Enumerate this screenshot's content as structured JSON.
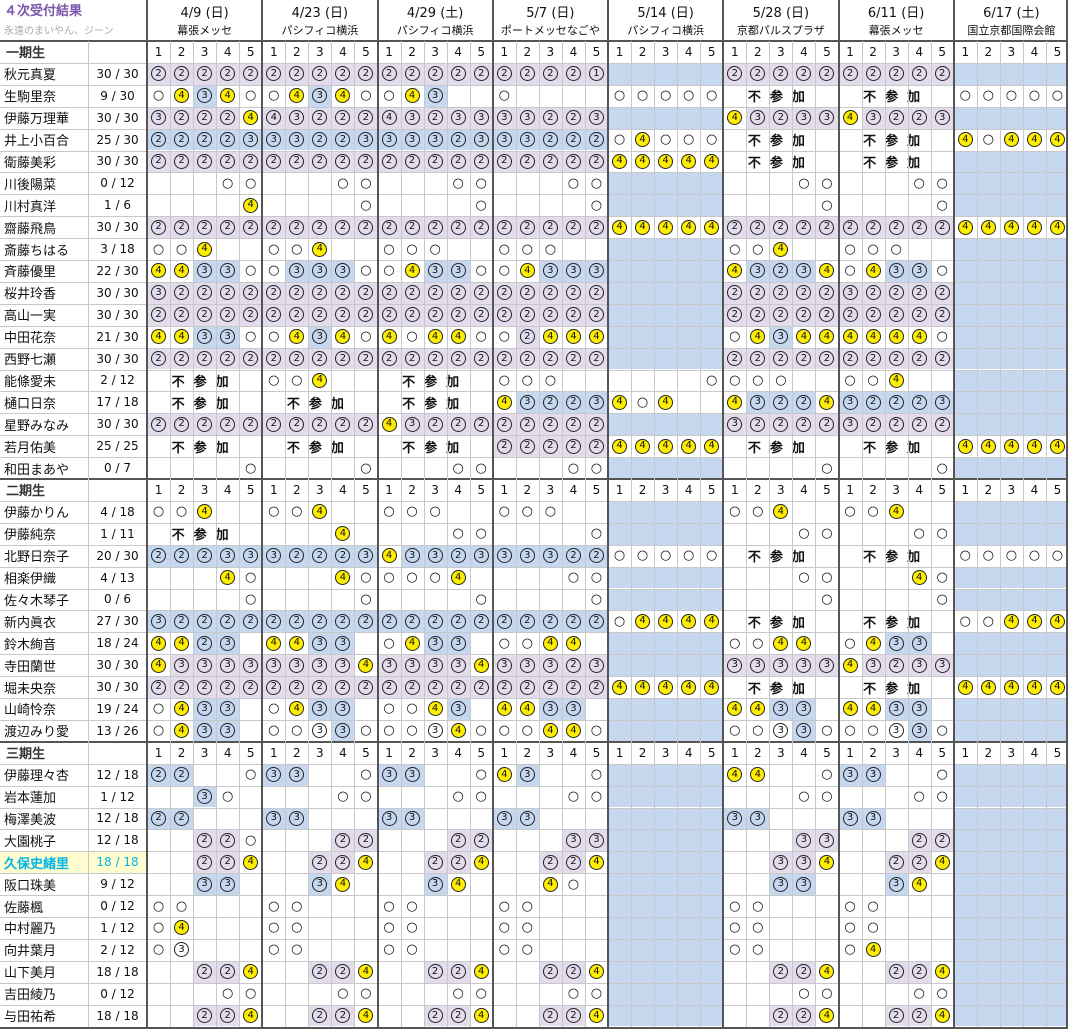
{
  "title": "４次受付結果",
  "subtitle": "永遠のまいやん、ジーン",
  "events": [
    {
      "date": "4/9 (日)",
      "venue": "幕張メッセ"
    },
    {
      "date": "4/23 (日)",
      "venue": "パシフィコ横浜"
    },
    {
      "date": "4/29 (土)",
      "venue": "パシフィコ横浜"
    },
    {
      "date": "5/7 (日)",
      "venue": "ポートメッセなごや"
    },
    {
      "date": "5/14 (日)",
      "venue": "パシフィコ横浜"
    },
    {
      "date": "5/28 (日)",
      "venue": "京都パルスプラザ"
    },
    {
      "date": "6/11 (日)",
      "venue": "幕張メッセ"
    },
    {
      "date": "6/17 (土)",
      "venue": "国立京都国際会館"
    }
  ],
  "slots": [
    "1",
    "2",
    "3",
    "4",
    "5"
  ],
  "fushanka": "不参加",
  "legend": {
    "B": "#c5d8f0",
    "L": "#e2dcec",
    "Y": "#ffee00",
    "o": "○",
    "r2": "②",
    "r3": "③",
    "r4": "④",
    "r1": "①"
  },
  "colors": {
    "title": "#7a55a8",
    "highlight_name": "#00b7e6",
    "highlight_bg": "#fffccf"
  },
  "sections": [
    {
      "label": "一期生",
      "members": [
        {
          "name": "秋元真夏",
          "count": "30 / 30",
          "rows": [
            "L2L2L2L2L2",
            "L2L2L2L2L2",
            "L2L2L2L2L2",
            "L2L2L2L2L1",
            "BBBBB",
            "L2L2L2L2L2",
            "L2L2L2L2L2",
            "BBBBB"
          ]
        },
        {
          "name": "生駒里奈",
          "count": "9 / 30",
          "rows": [
            " o Y4 B3 Y4 o",
            " o Y4 B3 Y4 o",
            " o Y4 B3 .. ..",
            " o .. .. Y4 o",
            "ooooo",
            "F",
            "F",
            "ooooo"
          ]
        },
        {
          "name": "伊藤万理華",
          "count": "30 / 30",
          "rows": [
            "L3L2L2L2Y4",
            "L4L3L2L2L2",
            "L4L3L2L3L3",
            "L3L3L2L2L3",
            "BBBBB",
            "Y4L3L2L3L3",
            "Y4L3L2L2L3",
            "BBBBB"
          ]
        },
        {
          "name": "井上小百合",
          "count": "25 / 30",
          "rows": [
            "B2B2B2B2B3",
            "B3B3B2B2B3",
            "B3B3B3B2B3",
            "B3B3B2B2B2",
            "oY4ooo",
            "F",
            "F",
            "Y4oY4Y4Y4"
          ]
        },
        {
          "name": "衛藤美彩",
          "count": "30 / 30",
          "rows": [
            "L2L2L2L2L2",
            "L2L2L2L2L2",
            "L2L2L2L2L2",
            "L2L2L2L2L2",
            "Y4Y4Y4Y4Y4",
            "F",
            "F",
            "BBBBB"
          ]
        },
        {
          "name": "川後陽菜",
          "count": "0 / 12",
          "rows": [
            "...oo",
            "...oo",
            "...oo",
            "...oo",
            "BBBBB",
            "...oo",
            "...oo",
            "BBBBB"
          ]
        },
        {
          "name": "川村真洋",
          "count": "1 / 6",
          "rows": [
            "....Y4",
            "....o",
            "....o",
            "....o",
            "BBBBB",
            "....o",
            "....o",
            "BBBBB"
          ]
        },
        {
          "name": "齋藤飛鳥",
          "count": "30 / 30",
          "rows": [
            "L2L2L2L2L2",
            "L2L2L2L2L2",
            "L2L2L2L2L2",
            "L2L2L2L2L2",
            "Y4Y4Y4Y4Y4",
            "L2L2L2L2L2",
            "L2L2L2L2L2",
            "Y4Y4Y4Y4Y4"
          ]
        },
        {
          "name": "斎藤ちはる",
          "count": "3 / 18",
          "rows": [
            "ooY4..",
            "ooY4..",
            "ooo..",
            "ooo..",
            "BBBBB",
            "ooY4..",
            "ooo..",
            "BBBBB"
          ]
        },
        {
          "name": "斉藤優里",
          "count": "22 / 30",
          "rows": [
            "Y4Y4B3B3o",
            "oB3B3B3o",
            "oY4B3B3o",
            "oY4B3B3B3",
            "BBBBB",
            "Y4B3B2B3Y4",
            "oY4B3B3o",
            "BBBBB"
          ]
        },
        {
          "name": "桜井玲香",
          "count": "30 / 30",
          "rows": [
            "L3L2L2L2L2",
            "L2L2L2L2L2",
            "L2L2L2L2L2",
            "L2L2L2L2L2",
            "BBBBB",
            "L2L2L2L2L2",
            "L3L2L2L2L2",
            "BBBBB"
          ]
        },
        {
          "name": "高山一実",
          "count": "30 / 30",
          "rows": [
            "L2L2L2L2L2",
            "L2L2L2L2L2",
            "L2L2L2L2L2",
            "L2L2L2L2L2",
            "BBBBB",
            "L2L2L2L2L2",
            "L2L2L2L2L2",
            "BBBBB"
          ]
        },
        {
          "name": "中田花奈",
          "count": "21 / 30",
          "rows": [
            "Y4Y4B3B3o",
            "oY4B3Y4o",
            "Y4oY4Y4o",
            "oL2Y4Y4Y4",
            "BBBBB",
            "oY4B3Y4Y4",
            "Y4Y4Y4Y4o",
            "BBBBB"
          ]
        },
        {
          "name": "西野七瀬",
          "count": "30 / 30",
          "rows": [
            "L2L2L2L2L2",
            "L2L2L2L2L2",
            "L2L2L2L2L2",
            "L2L2L2L2L2",
            "BBBBB",
            "L2L2L2L2L2",
            "L2L2L2L2L2",
            "BBBBB"
          ]
        },
        {
          "name": "能條愛未",
          "count": "2 / 12",
          "rows": [
            "F",
            "ooY4..",
            "F",
            "ooo..",
            "....o",
            "ooo..",
            "ooY4..",
            "BBBBB"
          ]
        },
        {
          "name": "樋口日奈",
          "count": "17 / 18",
          "rows": [
            "F",
            "F",
            "F",
            "Y4B3B2B2B3",
            "Y4oY4..",
            "Y4B3B2B2Y4",
            "B3B2B2B2B3",
            "BBBBB"
          ]
        },
        {
          "name": "星野みなみ",
          "count": "30 / 30",
          "rows": [
            "L2L2L2L2L2",
            "L2L2L2L2L2",
            "Y4L3L2L2L2",
            "L2L2L2L2L2",
            "BBBBB",
            "L3L2L2L2L2",
            "L3L2L2L2L2",
            "BBBBB"
          ]
        },
        {
          "name": "若月佑美",
          "count": "25 / 25",
          "rows": [
            "F",
            "F",
            "F",
            "L2L2L2L2L2",
            "Y4Y4Y4Y4Y4",
            "F",
            "F",
            "Y4Y4Y4Y4Y4"
          ]
        },
        {
          "name": "和田まあや",
          "count": "0 / 7",
          "rows": [
            "....o",
            "....o",
            "...oo",
            "...oo",
            "BBBBB",
            "....o",
            "....o",
            "BBBBB"
          ]
        }
      ]
    },
    {
      "label": "二期生",
      "members": [
        {
          "name": "伊藤かりん",
          "count": "4 / 18",
          "rows": [
            "ooY4..",
            "ooY4..",
            "ooo..",
            "ooo..",
            "BBBBB",
            "ooY4..",
            "ooY4..",
            "BBBBB"
          ]
        },
        {
          "name": "伊藤純奈",
          "count": "1 / 11",
          "rows": [
            "F",
            "...Y4.",
            "...oo",
            "....o",
            "BBBBB",
            "...oo",
            "...oo",
            "BBBBB"
          ]
        },
        {
          "name": "北野日奈子",
          "count": "20 / 30",
          "rows": [
            "B2B2B2B3B3",
            "B3B2B2B2B3",
            "Y4B3B3B2B3",
            "B3B3B3B2B2",
            "ooooo",
            "F",
            "F",
            "ooooo"
          ]
        },
        {
          "name": "相楽伊織",
          "count": "4 / 13",
          "rows": [
            "...Y4o",
            "...Y4o",
            "oooY4.",
            "...oo",
            "BBBBB",
            "...oo",
            "...Y4o",
            "BBBBB"
          ]
        },
        {
          "name": "佐々木琴子",
          "count": "0 / 6",
          "rows": [
            "....o",
            "....o",
            "....o",
            "....o",
            "BBBBB",
            "....o",
            "....o",
            "BBBBB"
          ]
        },
        {
          "name": "新内眞衣",
          "count": "27 / 30",
          "rows": [
            "B3B2B2B2B2",
            "B2B2B2B2B2",
            "B2B2B2B2B2",
            "B2B2B2B2B2",
            "oY4Y4Y4Y4",
            "F",
            "F",
            "ooY4Y4Y4"
          ]
        },
        {
          "name": "鈴木絢音",
          "count": "18 / 24",
          "rows": [
            "Y4Y4B2B3.",
            "Y4Y4B3B3.",
            "oY4B3B3.",
            "ooY4Y4.",
            "BBBBB",
            "ooY4Y4.",
            "oY4B3B3.",
            "BBBBB"
          ]
        },
        {
          "name": "寺田蘭世",
          "count": "30 / 30",
          "rows": [
            "Y4L3L3L3L3",
            "L3L3L3L3Y4",
            "L3L3L3L3Y4",
            "L3L3L3L2L3",
            "BBBBB",
            "L3L3L3L3L3",
            "Y4L3L2L3L3",
            "BBBBB"
          ]
        },
        {
          "name": "堀未央奈",
          "count": "30 / 30",
          "rows": [
            "L2L2L2L2L2",
            "L2L2L2L2L2",
            "L2L2L2L2L2",
            "L2L2L2L2L2",
            "Y4Y4Y4Y4Y4",
            "F",
            "F",
            "Y4Y4Y4Y4Y4"
          ]
        },
        {
          "name": "山崎怜奈",
          "count": "19 / 24",
          "rows": [
            "oY4B3B3.",
            "oY4B3B3.",
            "ooY4B3.",
            "Y4Y4B3B3.",
            "BBBBB",
            "Y4Y4B3B3.",
            "Y4Y4B3B3.",
            "BBBBB"
          ]
        },
        {
          "name": "渡辺みり愛",
          "count": "13 / 26",
          "rows": [
            "oY4B3B3.",
            "oo3B3o",
            "oo3Y4o",
            "ooY4Y4o",
            "BBBBB",
            "oo3B3o",
            "oo3B3o",
            "BBBBB"
          ]
        }
      ]
    },
    {
      "label": "三期生",
      "members": [
        {
          "name": "伊藤理々杏",
          "count": "12 / 18",
          "rows": [
            "B2B2..o",
            "B3B3..o",
            "B3B3..o",
            "Y4B3..o",
            "BBBBB",
            "Y4Y4..o",
            "B3B3..o",
            "BBBBB"
          ]
        },
        {
          "name": "岩本蓮加",
          "count": "1 / 12",
          "rows": [
            "..B3o.",
            "...oo",
            "...oo",
            "...oo",
            "BBBBB",
            "...oo",
            "...oo",
            "BBBBB"
          ]
        },
        {
          "name": "梅澤美波",
          "count": "12 / 18",
          "rows": [
            "B2B2...",
            "B3B3...",
            "B3B3...",
            "B3B3...",
            "BBBBB",
            "B3B3...",
            "B3B3...",
            "BBBBB"
          ]
        },
        {
          "name": "大園桃子",
          "count": "12 / 18",
          "rows": [
            "..L2L2o",
            "...L2L2o",
            "...L2L2o",
            "...L3L3o",
            "BBBBB",
            "...L3L3o",
            "...L2L2o",
            "BBBBB"
          ]
        },
        {
          "name": "久保史緒里",
          "count": "18 / 18",
          "hl": true,
          "rows": [
            "..L2L2Y4",
            "..L2L2Y4",
            "..L2L2Y4",
            "..L2L2Y4",
            "BBBBB",
            "..L3L3Y4",
            "..L2L2Y4",
            "BBBBB"
          ]
        },
        {
          "name": "阪口珠美",
          "count": "9 / 12",
          "rows": [
            "..B3B3.",
            "..B3Y4.",
            "..B3Y4.",
            "..Y4o.",
            "BBBBB",
            "..B3B3.",
            "..B3Y4.",
            "BBBBB"
          ]
        },
        {
          "name": "佐藤楓",
          "count": "0 / 12",
          "rows": [
            "oo...",
            "oo...",
            "oo...",
            "oo...",
            "BBBBB",
            "oo...",
            "oo...",
            "BBBBB"
          ]
        },
        {
          "name": "中村麗乃",
          "count": "1 / 12",
          "rows": [
            "oY4...",
            "oo...",
            "oo...",
            "oo...",
            "BBBBB",
            "oo...",
            "oo...",
            "BBBBB"
          ]
        },
        {
          "name": "向井葉月",
          "count": "2 / 12",
          "rows": [
            "o3...",
            "oo...",
            "oo...",
            "oo...",
            "BBBBB",
            "oo...",
            "oY4...",
            "BBBBB"
          ]
        },
        {
          "name": "山下美月",
          "count": "18 / 18",
          "rows": [
            "..L2L2Y4",
            "..L2L2Y4",
            "..L2L2Y4",
            "..L2L2Y4",
            "BBBBB",
            "..L2L2Y4",
            "..L2L2Y4",
            "BBBBB"
          ]
        },
        {
          "name": "吉田綾乃",
          "count": "0 / 12",
          "rows": [
            "...oo",
            "...oo",
            "...oo",
            "...oo",
            "BBBBB",
            "...oo",
            "...oo",
            "BBBBB"
          ]
        },
        {
          "name": "与田祐希",
          "count": "18 / 18",
          "rows": [
            "..L2L2Y4",
            "..L2L2Y4",
            "..L2L2Y4",
            "..L2L2Y4",
            "BBBBB",
            "..L2L2Y4",
            "..L2L2Y4",
            "BBBBB"
          ]
        }
      ]
    }
  ]
}
